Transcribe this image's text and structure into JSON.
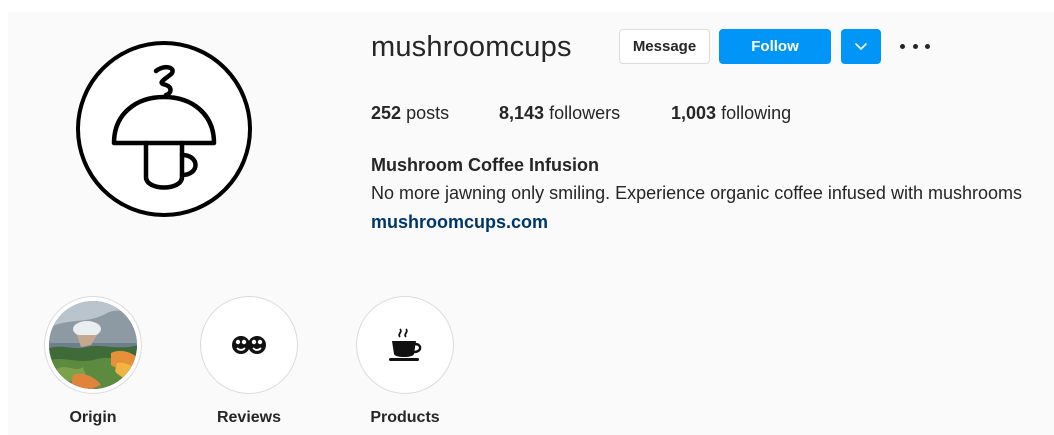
{
  "profile": {
    "username": "mushroomcups",
    "message_label": "Message",
    "follow_label": "Follow",
    "full_name": "Mushroom Coffee Infusion",
    "bio": "No more jawning only smiling. Experience organic coffee infused with mushrooms",
    "website": "mushroomcups.com"
  },
  "stats": {
    "posts_count": "252",
    "posts_label": "posts",
    "followers_count": "8,143",
    "followers_label": "followers",
    "following_count": "1,003",
    "following_label": "following"
  },
  "highlights": [
    {
      "label": "Origin",
      "icon": "photo-thumbnail"
    },
    {
      "label": "Reviews",
      "icon": "faces-emoji",
      "glyph": "👥"
    },
    {
      "label": "Products",
      "icon": "coffee-cup-icon",
      "glyph": "☕"
    }
  ],
  "colors": {
    "accent": "#0095f6",
    "link": "#00376b",
    "text": "#262626",
    "panel": "#fafafa"
  }
}
